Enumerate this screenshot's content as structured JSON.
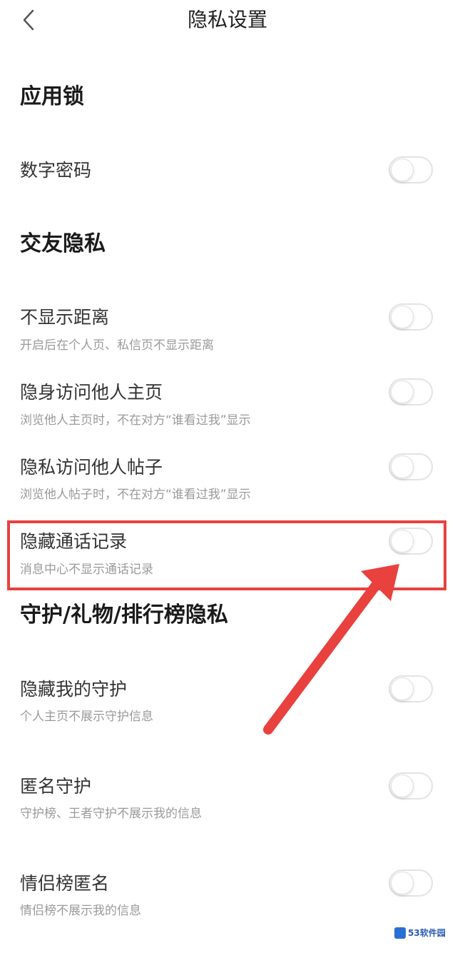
{
  "header": {
    "title": "隐私设置"
  },
  "sections": {
    "app_lock": "应用锁",
    "social": "交友隐私",
    "guard": "守护/礼物/排行榜隐私"
  },
  "rows": [
    {
      "title": "数字密码",
      "subtitle": "",
      "on": false
    },
    {
      "title": "不显示距离",
      "subtitle": "开启后在个人页、私信页不显示距离",
      "on": false
    },
    {
      "title": "隐身访问他人主页",
      "subtitle": "浏览他人主页时，不在对方“谁看过我”显示",
      "on": false
    },
    {
      "title": "隐私访问他人帖子",
      "subtitle": "浏览他人帖子时，不在对方“谁看过我”显示",
      "on": false
    },
    {
      "title": "隐藏通话记录",
      "subtitle": "消息中心不显示通话记录",
      "on": false
    },
    {
      "title": "隐藏我的守护",
      "subtitle": "个人主页不展示守护信息",
      "on": false
    },
    {
      "title": "匿名守护",
      "subtitle": "守护榜、王者守护不展示我的信息",
      "on": false
    },
    {
      "title": "情侣榜匿名",
      "subtitle": "情侣榜不展示我的信息",
      "on": false
    }
  ],
  "annotation": {
    "color": "#e8413e"
  },
  "watermark": {
    "text": "53软件园",
    "icon": "logo-icon"
  }
}
